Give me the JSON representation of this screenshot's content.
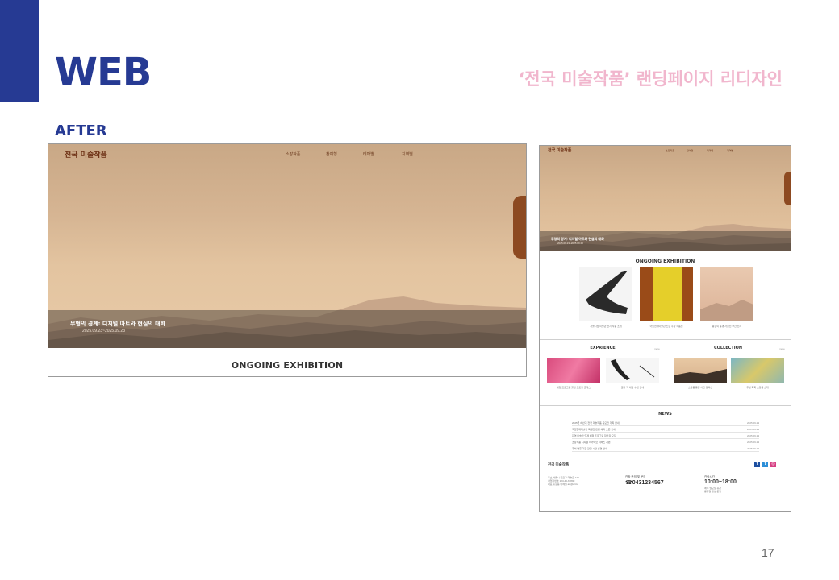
{
  "slide": {
    "heading": "WEB",
    "subtitle": "‘전국 미술작품’ 랜딩페이지 리디자인",
    "section_label": "AFTER",
    "page_number": "17",
    "accent_color": "#263a93",
    "subtitle_color": "#f1b6cd"
  },
  "site": {
    "logo": "전국 미술작품",
    "nav": [
      "소장작품",
      "참여형",
      "테마별",
      "지역별"
    ],
    "hero": {
      "title": "무형의 경계: 디지털 아트와 현실의 대화",
      "date": "2025.09.23~2025.09.23"
    },
    "ongoing": {
      "title": "ONGOING EXHIBITION",
      "captions": [
        "서울시립 미술관 전시 작품 소개",
        "국립현대미술관 노란 추상 작품전",
        "황혼의 풍경 사진전 부산 전시"
      ]
    },
    "experience": {
      "title": "EXPRIENCE",
      "more": "more",
      "captions": [
        "체험 프로그램 물감 드로잉 클래스",
        "붓과 먹 체험 수업 안내"
      ]
    },
    "collection": {
      "title": "COLLECTION",
      "more": "more",
      "captions": [
        "소장품 풍경 사진 컬렉션",
        "추상 회화 소장품 소개"
      ]
    },
    "news": {
      "title": "NEWS",
      "items": [
        {
          "text": "2025년 하반기 전국 미술작품 공모전 개최 안내",
          "date": "2025.09.23"
        },
        {
          "text": "국립현대미술관 특별전 관람 예약 오픈 안내",
          "date": "2025.09.23"
        },
        {
          "text": "지역 미술관 연계 체험 프로그램 참가자 모집",
          "date": "2025.09.23"
        },
        {
          "text": "소장작품 디지털 아카이브 서비스 개편",
          "date": "2025.09.23"
        },
        {
          "text": "추석 연휴 기간 관람 시간 변경 안내",
          "date": "2025.09.23"
        }
      ]
    },
    "footer": {
      "logo": "전국 미술작품",
      "address_lines": [
        "주소 서울시 종로구 미술로 123",
        "사업자번호 123-45-67890",
        "대표 홍길동 이메일 art@art.kr"
      ],
      "phone_label": "관람 문의 및 문의",
      "phone": "☎0431234567",
      "hours_label": "관람시간",
      "hours": "10:00~18:00",
      "hours_notes": [
        "매주 월요일 휴관",
        "공휴일 정상 운영"
      ],
      "sns_icons": [
        "facebook-icon",
        "twitter-icon",
        "instagram-icon"
      ]
    }
  }
}
